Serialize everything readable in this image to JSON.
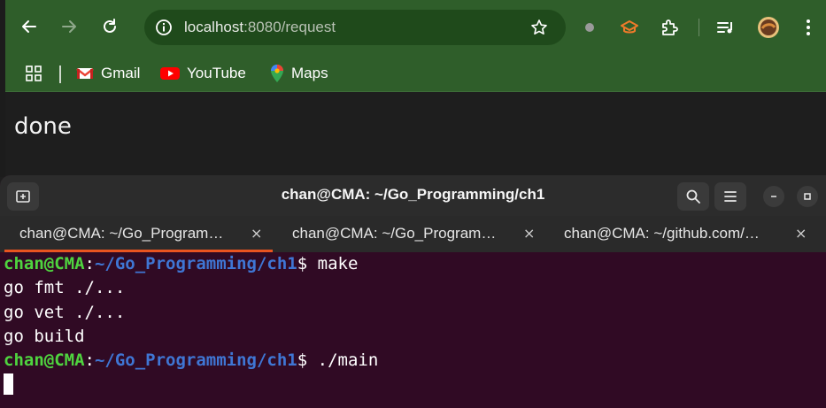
{
  "browser": {
    "url_host": "localhost",
    "url_rest": ":8080/request",
    "bookmarks": {
      "gmail": "Gmail",
      "youtube": "YouTube",
      "maps": "Maps"
    },
    "page_text": "done"
  },
  "terminal": {
    "title": "chan@CMA: ~/Go_Programming/ch1",
    "tabs": [
      {
        "label": "chan@CMA: ~/Go_Program…"
      },
      {
        "label": "chan@CMA: ~/Go_Program…"
      },
      {
        "label": "chan@CMA: ~/github.com/…"
      }
    ],
    "tab_close": "×",
    "prompt_user": "chan@CMA",
    "prompt_colon": ":",
    "prompt_path": "~/Go_Programming/ch1",
    "lines": {
      "cmd1": "$ make",
      "out1": "go fmt ./...",
      "out2": "go vet ./...",
      "out3": "go build",
      "cmd2": "$ ./main"
    }
  },
  "colors": {
    "browser_frame": "#2f5e2a",
    "terminal_bg": "#300a24",
    "prompt_user": "#4fd43f",
    "prompt_path": "#3f76d4",
    "active_tab_accent": "#e95420"
  },
  "icons": [
    "back-arrow-icon",
    "forward-arrow-icon",
    "reload-icon",
    "site-info-icon",
    "bookmark-star-icon",
    "incognito-dot-icon",
    "graduation-cap-icon",
    "extensions-puzzle-icon",
    "media-queue-icon",
    "profile-avatar-icon",
    "kebab-menu-icon",
    "apps-grid-icon",
    "gmail-icon",
    "youtube-icon",
    "maps-pin-icon",
    "new-tab-icon",
    "search-icon",
    "hamburger-menu-icon",
    "minimize-icon",
    "maximize-icon"
  ]
}
